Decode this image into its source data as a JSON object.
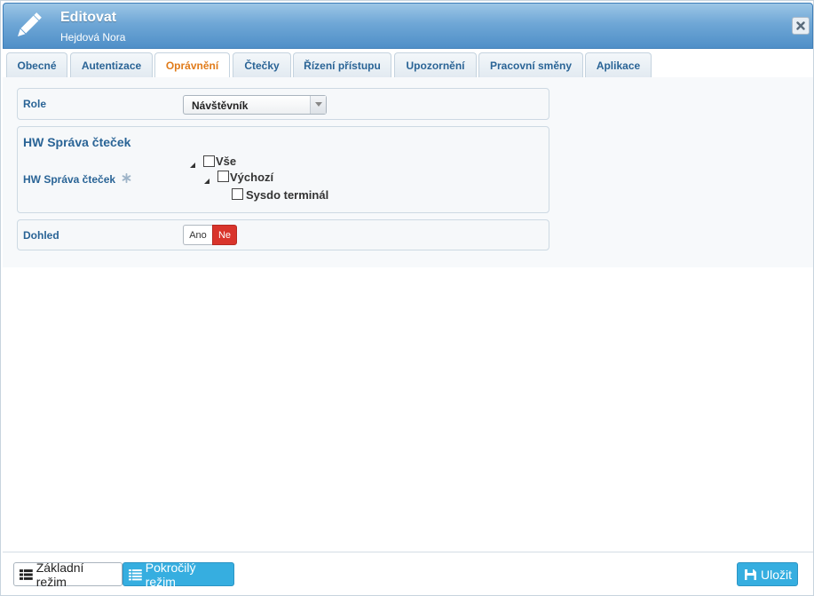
{
  "window": {
    "title": "Editovat",
    "subtitle": "Hejdová Nora",
    "title_icon": "pencil-icon",
    "close_icon": "close-icon"
  },
  "tabs": [
    {
      "label": "Obecné",
      "active": false
    },
    {
      "label": "Autentizace",
      "active": false
    },
    {
      "label": "Oprávnění",
      "active": true
    },
    {
      "label": "Čtečky",
      "active": false
    },
    {
      "label": "Řízení přístupu",
      "active": false
    },
    {
      "label": "Upozornění",
      "active": false
    },
    {
      "label": "Pracovní směny",
      "active": false
    },
    {
      "label": "Aplikace",
      "active": false
    }
  ],
  "role": {
    "label": "Role",
    "value": "Návštěvník"
  },
  "hw_readers": {
    "section_title": "HW Správa čteček",
    "field_label": "HW Správa čteček",
    "required_icon": "asterisk-icon",
    "tree": {
      "all": {
        "label": "Vše",
        "checked": false,
        "expanded": true
      },
      "default": {
        "label": "Výchozí",
        "checked": false,
        "expanded": true
      },
      "terminal": {
        "label": "Sysdo terminál",
        "checked": false
      }
    }
  },
  "supervision": {
    "label": "Dohled",
    "yes_label": "Ano",
    "no_label": "Ne",
    "selected": "Ne"
  },
  "footer": {
    "basic_mode_label": "Základní režim",
    "advanced_mode_label": "Pokročilý režim",
    "save_label": "Uložit"
  },
  "colors": {
    "accent": "#36aee0",
    "active_tab": "#e07b1a",
    "link": "#2a6496",
    "danger": "#d9342b",
    "titlebar": "#5b9bd0"
  }
}
